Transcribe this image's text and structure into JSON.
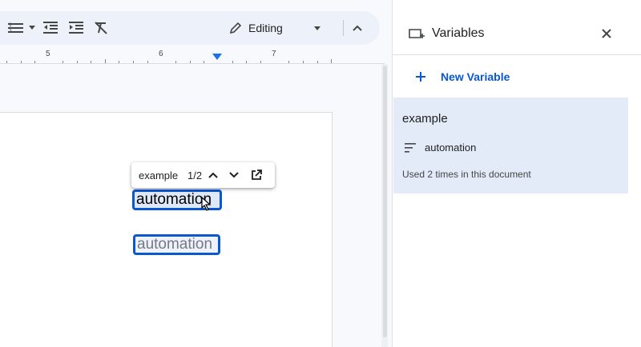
{
  "toolbar": {
    "mode_label": "Editing",
    "icons": [
      "numbered-list-icon",
      "decrease-indent-icon",
      "increase-indent-icon",
      "clear-formatting-icon",
      "pencil-icon",
      "collapse-chevron-icon"
    ]
  },
  "ruler": {
    "numbers": [
      "5",
      "6",
      "7"
    ]
  },
  "document": {
    "chips": [
      "automation",
      "automation"
    ],
    "popup": {
      "name": "example",
      "count": "1/2"
    }
  },
  "panel": {
    "title": "Variables",
    "new_variable_label": "New Variable",
    "variable": {
      "name": "example",
      "value": "automation",
      "usage": "Used 2 times in this document"
    }
  },
  "colors": {
    "accent": "#0b57d0",
    "toolbar_bg": "#edf2fa",
    "card_bg": "#e3ebf8"
  }
}
